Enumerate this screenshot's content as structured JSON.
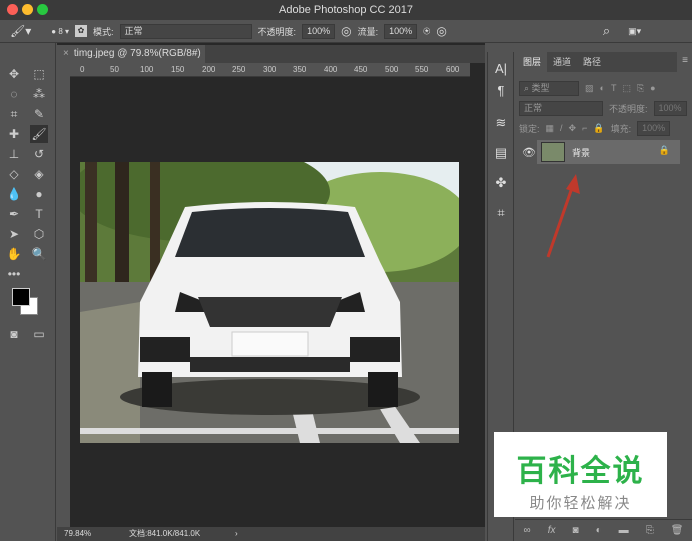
{
  "window": {
    "title": "Adobe Photoshop CC 2017"
  },
  "options": {
    "brush_size": "8",
    "mode_label": "模式:",
    "mode_value": "正常",
    "opacity_label": "不透明度:",
    "opacity_value": "100%",
    "flow_label": "流量:",
    "flow_value": "100%"
  },
  "document": {
    "tab_title": "timg.jpeg @ 79.8%(RGB/8#)",
    "ruler_ticks": [
      "0",
      "50",
      "100",
      "150",
      "200",
      "250",
      "300",
      "350",
      "400",
      "450",
      "500",
      "550",
      "600"
    ],
    "zoom": "79.84%",
    "doc_size": "文档:841.0K/841.0K"
  },
  "layers_panel": {
    "tabs": [
      "图层",
      "通道",
      "路径"
    ],
    "filter_label": "类型",
    "blend_mode": "正常",
    "opacity_label": "不透明度:",
    "opacity_value": "100%",
    "lock_label": "锁定:",
    "fill_label": "填充:",
    "fill_value": "100%",
    "layers": [
      {
        "name": "背景",
        "visible": true,
        "locked": true
      }
    ]
  },
  "watermark": {
    "title": "百科全说",
    "subtitle": "助你轻松解决"
  },
  "colors": {
    "accent_arrow": "#c0392b",
    "watermark_green": "#2db24a"
  }
}
